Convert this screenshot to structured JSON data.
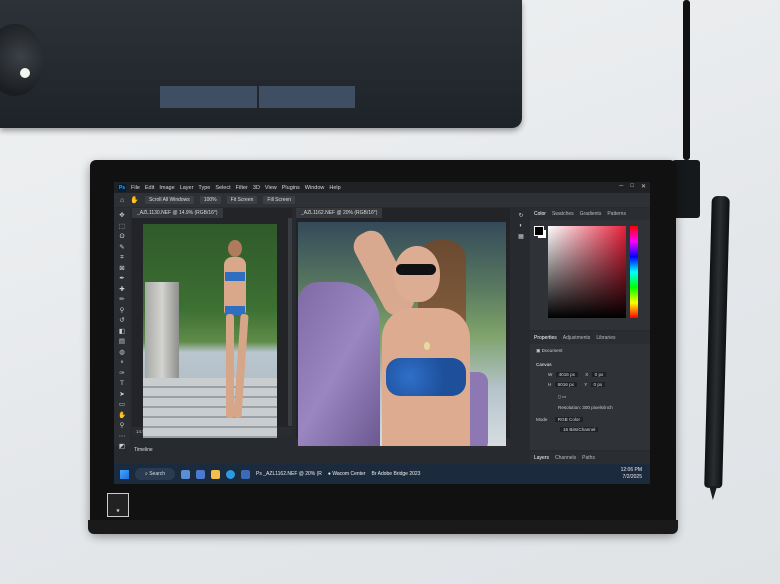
{
  "menu": {
    "items": [
      "File",
      "Edit",
      "Image",
      "Layer",
      "Type",
      "Select",
      "Filter",
      "3D",
      "View",
      "Plugins",
      "Window",
      "Help"
    ]
  },
  "options_bar": {
    "scroll_all": "Scroll All Windows",
    "zoom": "100%",
    "fit_screen": "Fit Screen",
    "fill_screen": "Fill Screen"
  },
  "documents": [
    {
      "tab": "_AZL1130.NEF @ 14.9% (RGB/16*)",
      "zoom": "14.95%"
    },
    {
      "tab": "_AZL1162.NEF @ 20% (RGB/16*)",
      "zoom": "19.96%",
      "info": "4016 px x 6016 px (300 ppi)"
    }
  ],
  "timeline_label": "Timeline",
  "color_panel": {
    "tabs": [
      "Color",
      "Swatches",
      "Gradients",
      "Patterns"
    ]
  },
  "properties_panel": {
    "tabs": [
      "Properties",
      "Adjustments",
      "Libraries"
    ],
    "doc_label": "Document",
    "canvas_label": "Canvas",
    "w_label": "W",
    "w_value": "4016 px",
    "h_label": "H",
    "h_value": "6016 px",
    "x_label": "X",
    "x_value": "0 px",
    "y_label": "Y",
    "y_value": "0 px",
    "resolution": "Resolution: 300 pixels/inch",
    "mode_label": "Mode",
    "mode_value": "RGB Color",
    "depth_value": "16 Bits/Channel"
  },
  "layers_panel": {
    "tabs": [
      "Layers",
      "Channels",
      "Paths"
    ]
  },
  "taskbar": {
    "search": "Search",
    "window1": "_AZL1162.NEF @ 20% (R",
    "window2": "Wacom Center",
    "window3": "Adobe Bridge 2023",
    "time": "12:06 PM",
    "date": "7/2/2025"
  }
}
